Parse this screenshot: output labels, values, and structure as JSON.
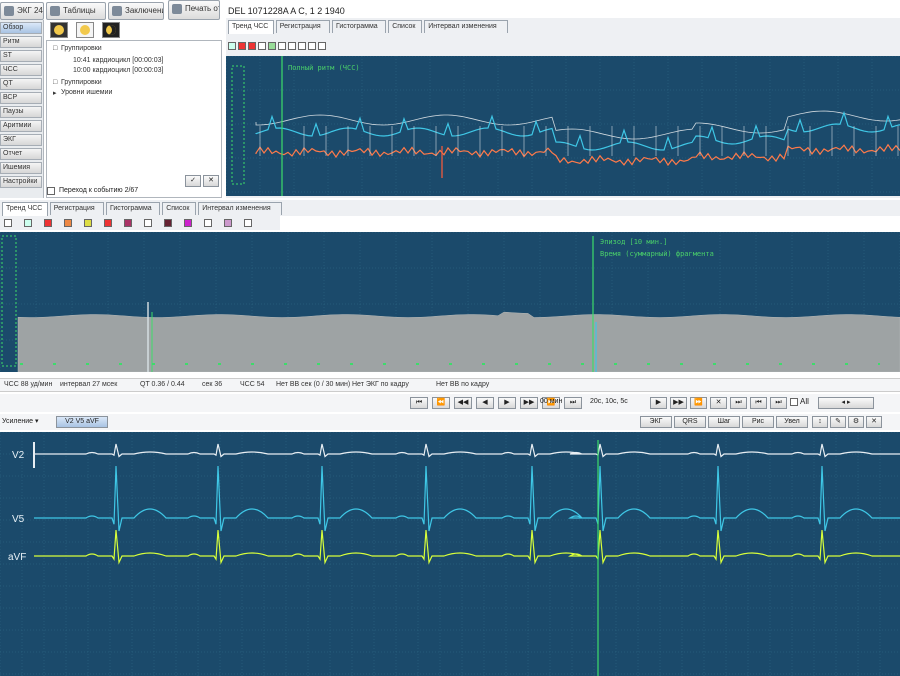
{
  "toolbar": {
    "buttons": [
      {
        "label": "ЭКГ 24",
        "icon": "monitor-icon"
      },
      {
        "label": "Таблицы",
        "icon": "table-icon"
      },
      {
        "label": "Заключение",
        "icon": "report-icon"
      },
      {
        "label": "Печать отчета",
        "icon": "print-icon"
      }
    ],
    "patient_title": "DEL 1071228A A C, 1 2 1940"
  },
  "sidebar": {
    "items": [
      "Обзор",
      "Ритм",
      "ST",
      "ЧСС",
      "QT",
      "ВСР",
      "Паузы",
      "Аритмии",
      "ЭКГ",
      "Отчет",
      "Ишемия",
      "Настройки"
    ]
  },
  "tree": {
    "root_label": "Группировки",
    "children": [
      "10:41 кардиоцикл [00:00:03]",
      "10:00 кардиоцикл [00:00:03]"
    ],
    "section2": "Группировки",
    "section3": "Уровни ишемии",
    "checkbox_label": "Переход к событию 2/67"
  },
  "top_tabs": [
    "Тренд ЧСС",
    "Регистрация",
    "Гистограмма",
    "Список",
    "Интервал изменения"
  ],
  "top_green_label": "Полный ритм (ЧСС)",
  "mid_tabs": [
    "Тренд ЧСС",
    "Регистрация",
    "Гистограмма",
    "Список",
    "Интервал изменения"
  ],
  "mid_green_labels": [
    "Эпизод [10 мин.]",
    "Время (суммарный) фрагмента"
  ],
  "status_bar": [
    "ЧСС 88 уд/мин",
    "интервал 27 мсек",
    "QT 0.36 / 0.44",
    "сек 36",
    "ЧСС 54",
    "Нет ВВ сек (0 / 30 мин)"
  ],
  "navigation": {
    "nav_left": "Нет ЭКГ по кадру",
    "nav_right": "Нет ВВ по кадру",
    "time_label": "00 мин",
    "time_value": "20с, 10с, 5с",
    "play_controls": [
      "⏮",
      "⏪",
      "◀◀",
      "◀",
      "▶",
      "▶▶",
      "⏩",
      "⏭"
    ],
    "all_label": "All"
  },
  "ecg_toolbar": {
    "dropdown": "Усиление",
    "leads_button": "V2 V5 aVF",
    "right_tools": [
      "ЭКГ",
      "QRS",
      "Шаг",
      "Рис",
      "Увел"
    ]
  },
  "leads": [
    "V2",
    "V5",
    "aVF"
  ],
  "colors": {
    "panel_bg": "#1b4a6b",
    "grid": "#2f6a86",
    "trend_cyan": "#3fc7e6",
    "trend_orange": "#ff7a4a",
    "ecg_white": "#e8eef3",
    "ecg_cyan": "#3fc7e6",
    "ecg_yellow": "#d8ff3a",
    "marker_green": "#3ddc6a"
  }
}
